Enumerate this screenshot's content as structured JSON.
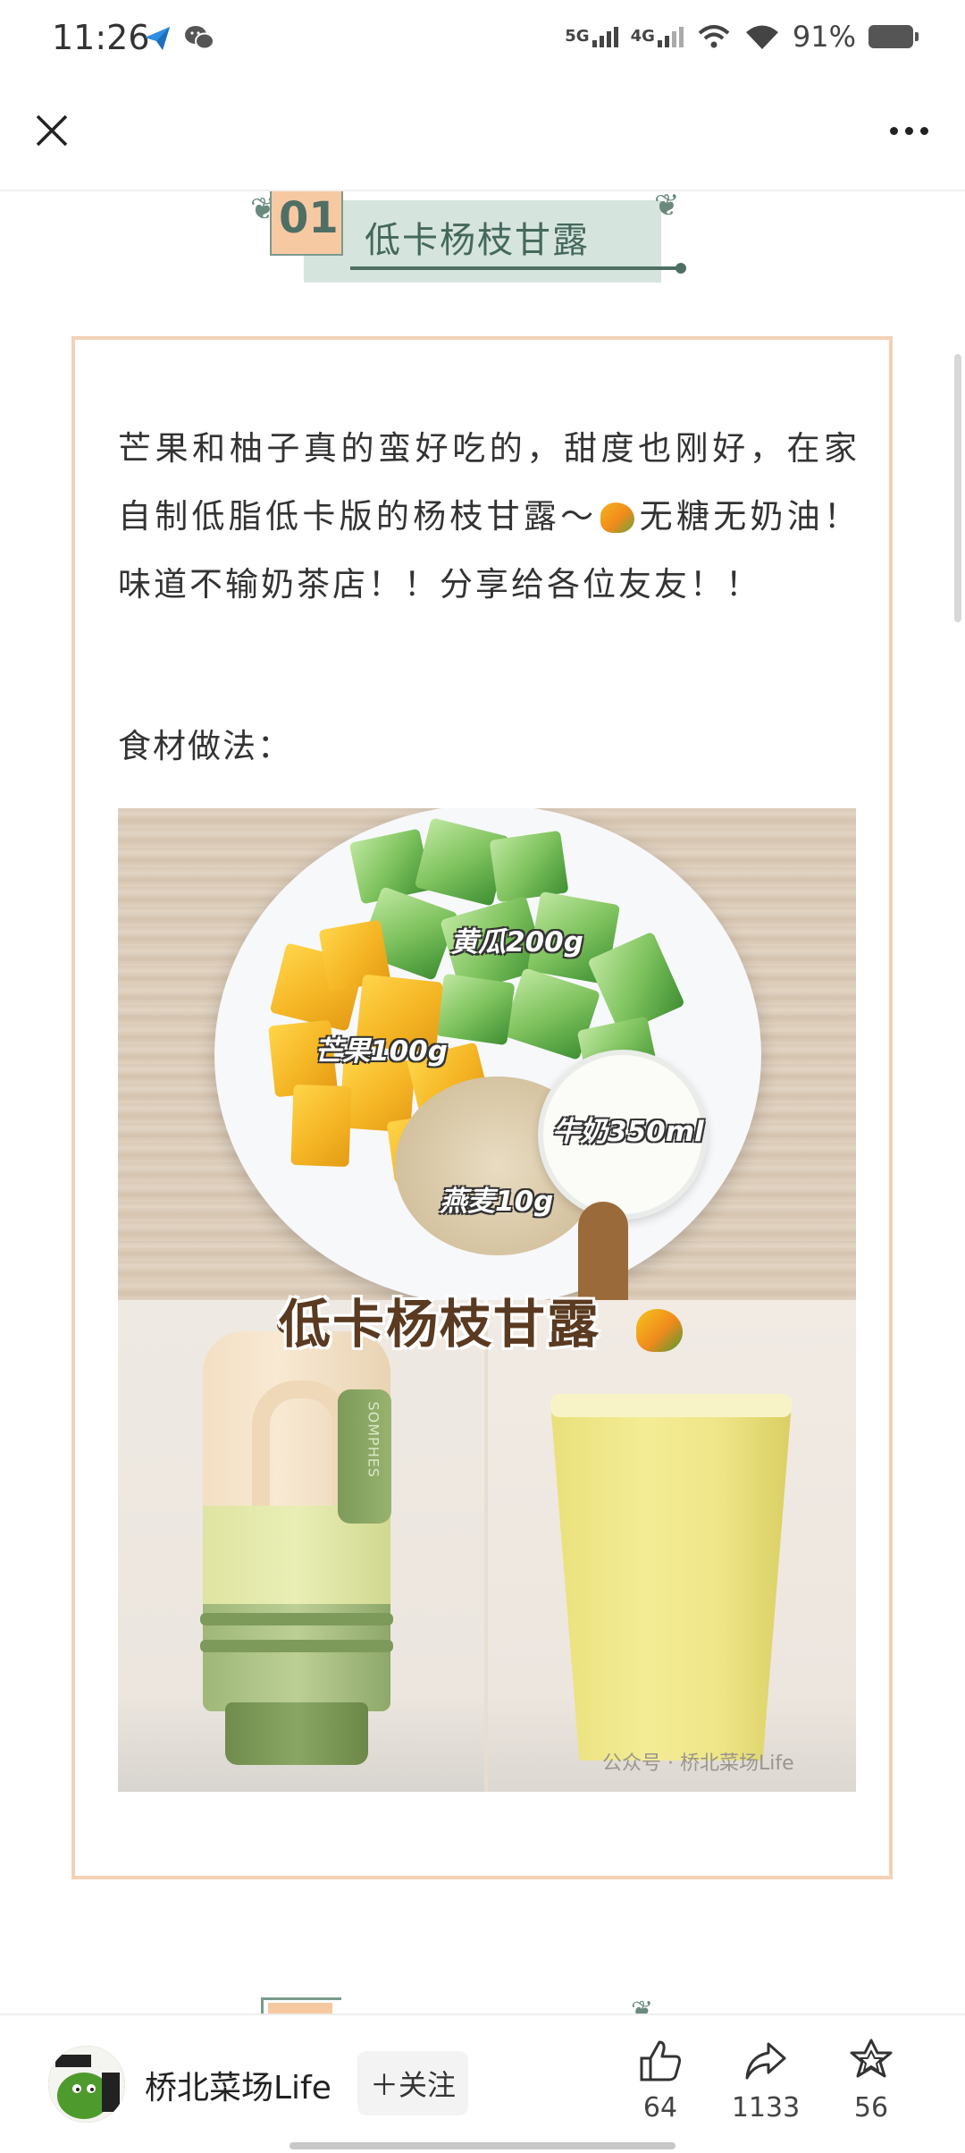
{
  "status_bar": {
    "time": "11:26",
    "network_1": "5G",
    "network_2": "4G",
    "battery": "91%"
  },
  "nav": {
    "close_icon": "close-icon",
    "more_icon": "more-dots-icon"
  },
  "section": {
    "number": "01",
    "title": "低卡杨枝甘露"
  },
  "article": {
    "intro_part1": "芒果和柚子真的蛮好吃的，甜度也刚好，在家自制低脂低卡版的杨枝甘露～",
    "intro_part2": "无糖无奶油！味道不输奶茶店！！分享给各位友友！！",
    "ingredients_label": "食材做法："
  },
  "recipe_image": {
    "label_cucumber": "黄瓜200g",
    "label_mango": "芒果100g",
    "label_milk": "牛奶350ml",
    "label_oats": "燕麦10g",
    "banner_title": "低卡杨枝甘露",
    "watermark": "公众号 · 桥北菜场Life",
    "bottle_brand": "SOMPHES"
  },
  "author": {
    "name": "桥北菜场Life",
    "follow_label": "＋关注"
  },
  "actions": {
    "like_count": "64",
    "share_count": "1133",
    "favorite_count": "56"
  },
  "colors": {
    "accent_peach": "#f7c9a2",
    "accent_green": "#4f6f65",
    "frame_border": "#f3d1b4"
  }
}
